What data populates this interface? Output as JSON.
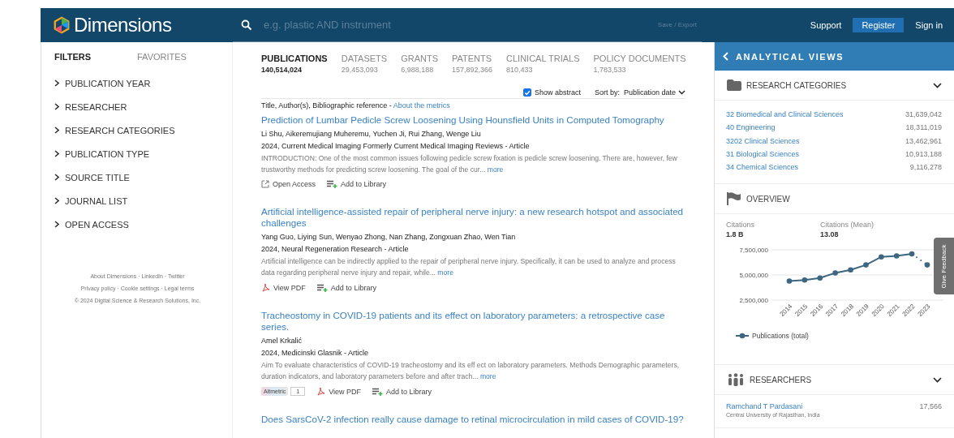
{
  "header": {
    "logo": "Dimensions",
    "search_placeholder": "e.g. plastic AND instrument",
    "save_export": "Save / Export",
    "links": [
      "Support",
      "Register",
      "Sign in"
    ]
  },
  "sidebar": {
    "tabs": [
      {
        "label": "FILTERS",
        "selected": true
      },
      {
        "label": "FAVORITES",
        "selected": false
      }
    ],
    "filters": [
      "PUBLICATION YEAR",
      "RESEARCHER",
      "RESEARCH CATEGORIES",
      "PUBLICATION TYPE",
      "SOURCE TITLE",
      "JOURNAL LIST",
      "OPEN ACCESS"
    ],
    "footer": [
      "About Dimensions · LinkedIn · Twitter",
      "Privacy policy · Cookie settings · Legal terms",
      "© 2024 Digital Science & Research Solutions, Inc."
    ]
  },
  "tabs": [
    {
      "label": "PUBLICATIONS",
      "count": "140,514,024",
      "selected": true
    },
    {
      "label": "DATASETS",
      "count": "29,453,093",
      "selected": false
    },
    {
      "label": "GRANTS",
      "count": "6,988,188",
      "selected": false
    },
    {
      "label": "PATENTS",
      "count": "157,892,366",
      "selected": false
    },
    {
      "label": "CLINICAL TRIALS",
      "count": "810,433",
      "selected": false
    },
    {
      "label": "POLICY DOCUMENTS",
      "count": "1,783,533",
      "selected": false
    }
  ],
  "show_abstract": {
    "label": "Show abstract",
    "checked": true
  },
  "sort": {
    "label": "Sort by:",
    "value": "Publication date"
  },
  "legend": {
    "text": "Title, Author(s), Bibliographic reference - ",
    "link": "About the metrics"
  },
  "results": [
    {
      "title": "Prediction of Lumbar Pedicle Screw Loosening Using Hounsfield Units in Computed Tomography",
      "authors": "Li Shu, Aikeremujiang Muheremu, Yuchen Ji, Rui Zhang, Wenge Liu",
      "reference": "2024, Current Medical Imaging Formerly Current Medical Imaging Reviews - Article",
      "abstract": "INTRODUCTION: One of the most common issues following pedicle screw fixation is pedicle screw loosening. There are, however, few trustworthy methods for predicting screw loosening. The goal of the cur...",
      "more": "more",
      "actions": [
        {
          "kind": "open-access",
          "label": "Open Access"
        },
        {
          "kind": "library",
          "label": "Add to Library"
        }
      ]
    },
    {
      "title": "Artificial intelligence-assisted repair of peripheral nerve injury: a new research hotspot and associated challenges",
      "authors": "Yang Guo, Liying Sun, Wenyao Zhong, Nan Zhang, Zongxuan Zhao, Wen Tian",
      "reference": "2024, Neural Regeneration Research - Article",
      "abstract": "Artificial intelligence can be indirectly applied to the repair of peripheral nerve injury. Specifically, it can be used to analyze and process data regarding peripheral nerve injury and repair, while...",
      "more": "more",
      "actions": [
        {
          "kind": "pdf",
          "label": "View PDF"
        },
        {
          "kind": "library",
          "label": "Add to Library"
        }
      ]
    },
    {
      "title": "Tracheostomy in COVID-19 patients and its effect on laboratory parameters: a retrospective case series.",
      "authors": "Amel Krkalić",
      "reference": "2024, Medicinski Glasnik - Article",
      "abstract": "Aim To evaluate characteristics of COVID-19 tracheostomy and its eff ect on laboratory parameters. Methods Demographic parameters, duration indicators, and laboratory parameters before and after trach...",
      "more": "more",
      "actions": [
        {
          "kind": "altmetric",
          "label": "Altmetric",
          "score": "1"
        },
        {
          "kind": "pdf",
          "label": "View PDF"
        },
        {
          "kind": "library",
          "label": "Add to Library"
        }
      ]
    },
    {
      "title": "Does SarsCoV-2 infection really cause damage to retinal microcirculation in mild cases of COVID-19?"
    }
  ],
  "analytics": {
    "title": "ANALYTICAL VIEWS",
    "categories": {
      "title": "RESEARCH CATEGORIES",
      "items": [
        {
          "name": "32 Biomedical and Clinical Sciences",
          "count": "31,639,042"
        },
        {
          "name": "40 Engineering",
          "count": "18,311,019"
        },
        {
          "name": "3202 Clinical Sciences",
          "count": "13,462,961"
        },
        {
          "name": "31 Biological Sciences",
          "count": "10,913,188"
        },
        {
          "name": "34 Chemical Sciences",
          "count": "9,116,278"
        }
      ]
    },
    "overview": {
      "title": "OVERVIEW",
      "stats": [
        {
          "label": "Citations",
          "value": "1.8 B"
        },
        {
          "label": "Citations (Mean)",
          "value": "13.08"
        }
      ],
      "chart_data": {
        "type": "line",
        "categories": [
          "2014",
          "2015",
          "2016",
          "2017",
          "2018",
          "2019",
          "2020",
          "2021",
          "2022",
          "2023"
        ],
        "series": [
          {
            "name": "Publications (total)",
            "color": "#3d6680",
            "marker": true,
            "values": [
              4400000,
              4500000,
              4700000,
              5200000,
              5500000,
              6000000,
              6800000,
              6900000,
              7100000,
              6000000
            ]
          }
        ],
        "ylim": [
          2500000,
          7500000
        ],
        "yticks": [
          {
            "value": 2500000,
            "label": "2,500,000"
          },
          {
            "value": 5000000,
            "label": "5,000,000"
          },
          {
            "value": 7500000,
            "label": "7,500,000"
          }
        ]
      }
    },
    "researchers": {
      "title": "RESEARCHERS",
      "items": [
        {
          "name": "Ramchand T Pardasani",
          "affiliation": "Central University of Rajasthan, India",
          "count": "17,566"
        }
      ]
    }
  },
  "feedback": "Give Feedback"
}
